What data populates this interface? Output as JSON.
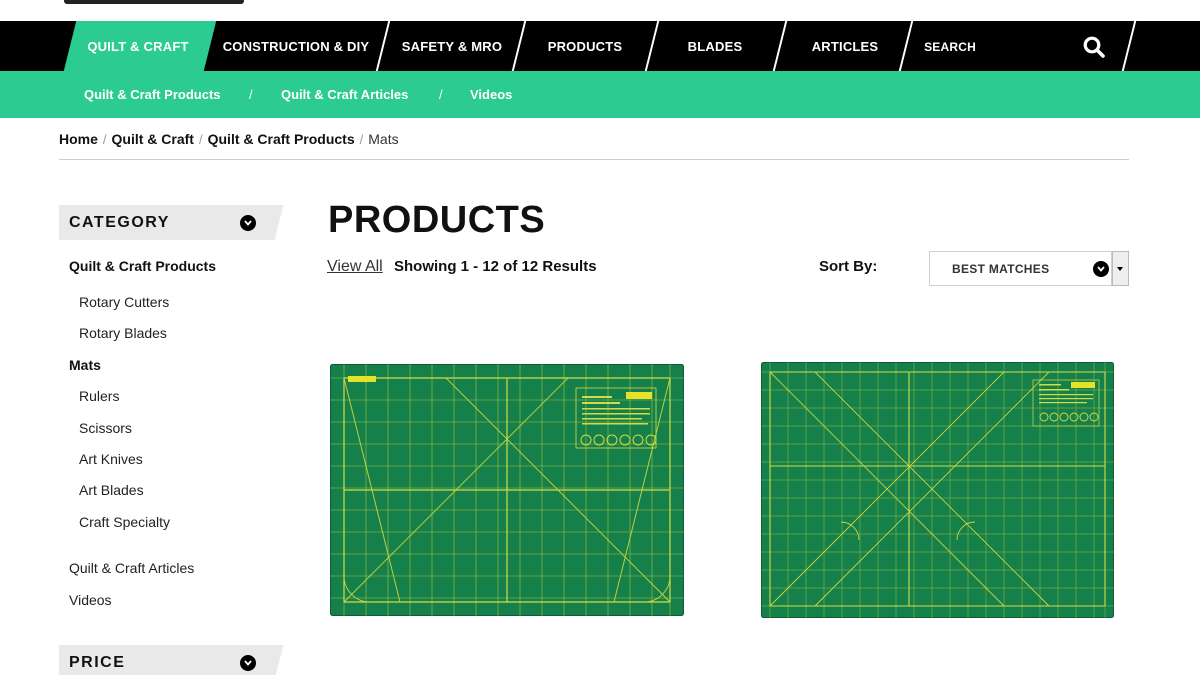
{
  "nav": {
    "items": [
      {
        "label": "QUILT & CRAFT",
        "active": true
      },
      {
        "label": "CONSTRUCTION & DIY"
      },
      {
        "label": "SAFETY & MRO"
      },
      {
        "label": "PRODUCTS"
      },
      {
        "label": "BLADES"
      },
      {
        "label": "ARTICLES"
      }
    ],
    "search_label": "SEARCH"
  },
  "subnav": {
    "items": [
      {
        "label": "Quilt & Craft Products"
      },
      {
        "label": "Quilt & Craft Articles"
      },
      {
        "label": "Videos"
      }
    ],
    "separator": "/"
  },
  "breadcrumb": {
    "links": [
      "Home",
      "Quilt & Craft",
      "Quilt & Craft Products"
    ],
    "current": "Mats",
    "separator": "/"
  },
  "sidebar": {
    "category_title": "CATEGORY",
    "price_title": "PRICE",
    "parent": "Quilt & Craft Products",
    "children_a": [
      "Rotary Cutters",
      "Rotary Blades"
    ],
    "active": "Mats",
    "children_b": [
      "Rulers",
      "Scissors",
      "Art Knives",
      "Art Blades",
      "Craft Specialty"
    ],
    "other": [
      "Quilt & Craft Articles",
      "Videos"
    ]
  },
  "main": {
    "title": "PRODUCTS",
    "view_all": "View All",
    "results": "Showing 1 - 12 of 12 Results",
    "sort_label": "Sort By:",
    "sort_value": "BEST MATCHES"
  },
  "colors": {
    "accent": "#2ccb92",
    "nav_bg": "#000000",
    "mat_green": "#16804b",
    "mat_line": "#c9d640"
  }
}
